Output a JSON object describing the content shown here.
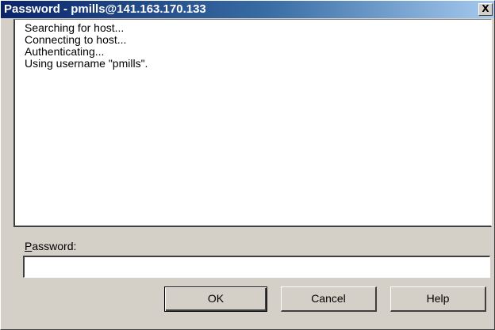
{
  "window": {
    "title": "Password - pmills@141.163.170.133",
    "close_label": "X"
  },
  "log": {
    "lines": [
      "Searching for host...",
      "Connecting to host...",
      "Authenticating...",
      "Using username \"pmills\"."
    ]
  },
  "password": {
    "label_accesskey": "P",
    "label_rest": "assword:",
    "value": "",
    "placeholder": ""
  },
  "buttons": {
    "ok_label": "OK",
    "cancel_label": "Cancel",
    "help_label": "Help"
  },
  "colors": {
    "titlebar_start": "#0a246a",
    "titlebar_end": "#a6caf0",
    "dialog_face": "#d4d0c8"
  }
}
